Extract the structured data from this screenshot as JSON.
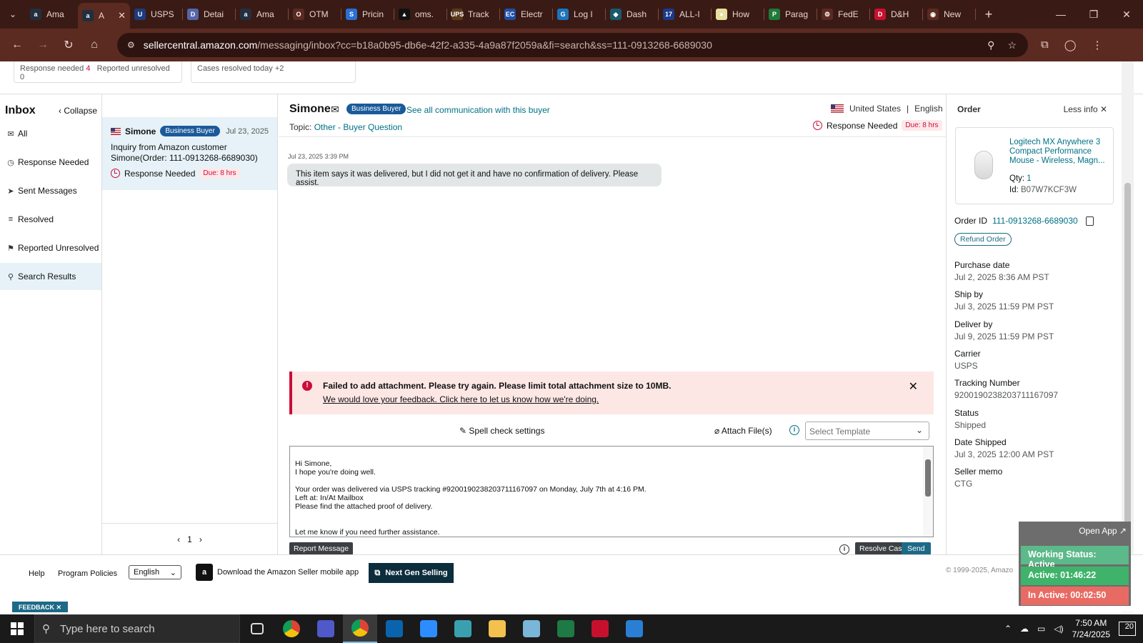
{
  "browser": {
    "tabs": [
      {
        "title": "Ama",
        "fav_color": "#232f3e",
        "fav_text": "a"
      },
      {
        "title": "A",
        "fav_color": "#232f3e",
        "fav_text": "a",
        "active": true
      },
      {
        "title": "USPS",
        "fav_color": "#1d3b7d",
        "fav_text": "U"
      },
      {
        "title": "Detai",
        "fav_color": "#5566aa",
        "fav_text": "D"
      },
      {
        "title": "Ama",
        "fav_color": "#232f3e",
        "fav_text": "a"
      },
      {
        "title": "OTM",
        "fav_color": "#5b2a20",
        "fav_text": "O"
      },
      {
        "title": "Pricin",
        "fav_color": "#2a6fd6",
        "fav_text": "S"
      },
      {
        "title": "oms.",
        "fav_color": "#111111",
        "fav_text": "▲"
      },
      {
        "title": "Track",
        "fav_color": "#5a3a1a",
        "fav_text": "UPS"
      },
      {
        "title": "Electr",
        "fav_color": "#1f4fa3",
        "fav_text": "EC"
      },
      {
        "title": "Log I",
        "fav_color": "#1c75bc",
        "fav_text": "G"
      },
      {
        "title": "Dash",
        "fav_color": "#1a5a6a",
        "fav_text": "◆"
      },
      {
        "title": "ALL-I",
        "fav_color": "#1a3a8a",
        "fav_text": "17"
      },
      {
        "title": "How",
        "fav_color": "#e8e0a0",
        "fav_text": "●"
      },
      {
        "title": "Parag",
        "fav_color": "#1f7a3a",
        "fav_text": "P"
      },
      {
        "title": "FedE",
        "fav_color": "#5b2a20",
        "fav_text": "⚙"
      },
      {
        "title": "D&H",
        "fav_color": "#c8102e",
        "fav_text": "D"
      },
      {
        "title": "New",
        "fav_color": "#5b2a20",
        "fav_text": "◉"
      }
    ],
    "url_host": "sellercentral.amazon.com",
    "url_path": "/messaging/inbox?cc=b18a0b95-db6e-42f2-a335-4a9a87f2059a&fi=search&ss=111-0913268-6689030"
  },
  "summary": {
    "response_needed_label": "Response needed",
    "response_needed_count": "4",
    "reported_unresolved_label": "Reported unresolved",
    "reported_unresolved_count": "0",
    "cases_resolved_label": "Cases resolved today",
    "cases_resolved_count": "+2"
  },
  "sidebar": {
    "title": "Inbox",
    "collapse": "Collapse",
    "items": [
      {
        "label": "All",
        "icon": "mail-icon"
      },
      {
        "label": "Response Needed",
        "icon": "clock-icon"
      },
      {
        "label": "Sent Messages",
        "icon": "send-icon"
      },
      {
        "label": "Resolved",
        "icon": "resolved-icon"
      },
      {
        "label": "Reported Unresolved",
        "icon": "report-icon"
      },
      {
        "label": "Search Results",
        "icon": "search-icon"
      }
    ]
  },
  "conversation_list": {
    "items": [
      {
        "name": "Simone",
        "badge": "Business Buyer",
        "date": "Jul 23, 2025",
        "line1": "Inquiry from Amazon customer",
        "line2": "Simone(Order: 111-0913268-6689030)",
        "status": "Response Needed",
        "due": "Due: 8 hrs"
      }
    ],
    "page": "1"
  },
  "conversation": {
    "buyer_name": "Simone",
    "badge": "Business Buyer",
    "see_all": "See all communication with this buyer",
    "country": "United States",
    "language": "English",
    "topic_label": "Topic:",
    "topic_value": "Other - Buyer Question",
    "status": "Response Needed",
    "due": "Due: 8 hrs",
    "message_time": "Jul 23, 2025 3:39 PM",
    "message_text": "This item says it was delivered, but I did not get it and have no confirmation of delivery. Please assist.",
    "alert_title": "Failed to add attachment. Please try again. Please limit total attachment size to 10MB.",
    "alert_link": "We would love your feedback. Click here to let us know how we're doing.",
    "spell_check": "Spell check settings",
    "attach": "Attach File(s)",
    "template_placeholder": "Select Template",
    "draft_text": "Hi Simone,\nI hope you're doing well.\n\nYour order was delivered via USPS tracking #9200190238203711167097 on Monday, July 7th at 4:16 PM.\nLeft at: In/At Mailbox\nPlease find the attached proof of delivery.\n\n\nLet me know if you need further assistance.\nThanks,",
    "report_button": "Report Message",
    "resolve_button": "Resolve Case",
    "send_button": "Send"
  },
  "order": {
    "title": "Order",
    "less_info": "Less info",
    "product_name": "Logitech MX Anywhere 3 Compact Performance Mouse - Wireless, Magn...",
    "qty_label": "Qty:",
    "qty": "1",
    "id_label": "Id:",
    "asin": "B07W7KCF3W",
    "order_id_label": "Order ID",
    "order_id": "111-0913268-6689030",
    "refund_button": "Refund Order",
    "fields": [
      {
        "label": "Purchase date",
        "value": "Jul 2, 2025 8:36 AM PST"
      },
      {
        "label": "Ship by",
        "value": "Jul 3, 2025 11:59 PM PST"
      },
      {
        "label": "Deliver by",
        "value": "Jul 9, 2025 11:59 PM PST"
      },
      {
        "label": "Carrier",
        "value": "USPS"
      },
      {
        "label": "Tracking Number",
        "value": "9200190238203711167097"
      },
      {
        "label": "Status",
        "value": "Shipped"
      },
      {
        "label": "Date Shipped",
        "value": "Jul 3, 2025 12:00 AM PST"
      },
      {
        "label": "Seller memo",
        "value": "CTG"
      }
    ]
  },
  "footer": {
    "help": "Help",
    "program_policies": "Program Policies",
    "language": "English",
    "app_download": "Download the Amazon Seller mobile app",
    "next_gen": "Next Gen Selling",
    "copyright": "© 1999-2025, Amazo",
    "feedback": "FEEDBACK"
  },
  "widget": {
    "open_app": "Open App ↗",
    "working_status": "Working Status: Active",
    "active": "Active: 01:46:22",
    "inactive": "In Active: 00:02:50",
    "colors": {
      "status": "#5cb98a",
      "active": "#3fb36a",
      "inactive": "#e86b63"
    }
  },
  "taskbar": {
    "search_placeholder": "Type here to search",
    "time": "7:50 AM",
    "date": "7/24/2025",
    "notifications": "20",
    "apps": [
      {
        "name": "task-view-icon",
        "color": "#1a1a1a"
      },
      {
        "name": "chrome-icon",
        "color": "#2f9e44"
      },
      {
        "name": "teams-icon",
        "color": "#5059c9"
      },
      {
        "name": "chrome-profile-icon",
        "color": "#c14a3a",
        "active": true
      },
      {
        "name": "outlook-icon",
        "color": "#0a64ad"
      },
      {
        "name": "zoom-icon",
        "color": "#2d8cff"
      },
      {
        "name": "app-diamond-icon",
        "color": "#3aa0b0"
      },
      {
        "name": "file-explorer-icon",
        "color": "#f2c14e"
      },
      {
        "name": "notepad-icon",
        "color": "#7ab6d9"
      },
      {
        "name": "excel-icon",
        "color": "#1d7a44"
      },
      {
        "name": "snipping-icon",
        "color": "#c8102e"
      },
      {
        "name": "photos-icon",
        "color": "#2a7fd4"
      }
    ]
  }
}
